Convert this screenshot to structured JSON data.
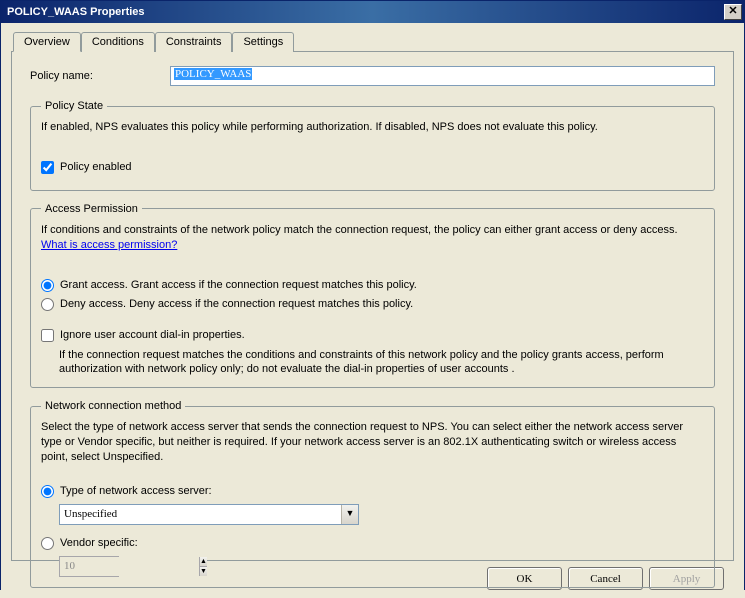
{
  "window": {
    "title": "POLICY_WAAS Properties",
    "close_glyph": "✕"
  },
  "tabs": {
    "overview": "Overview",
    "conditions": "Conditions",
    "constraints": "Constraints",
    "settings": "Settings"
  },
  "policy_name": {
    "label": "Policy name:",
    "value": "POLICY_WAAS"
  },
  "policy_state": {
    "legend": "Policy State",
    "desc": "If enabled, NPS evaluates this policy while performing authorization. If disabled, NPS does not evaluate this policy.",
    "enabled_label": "Policy enabled"
  },
  "access_permission": {
    "legend": "Access Permission",
    "desc_prefix": "If conditions and constraints of the network policy match the connection request, the policy can either grant access or deny access. ",
    "link_text": "What is access permission?",
    "grant_label": "Grant access. Grant access if the connection request matches this policy.",
    "deny_label": "Deny access. Deny access if the connection request matches this policy.",
    "ignore_label": "Ignore user account dial-in properties.",
    "ignore_desc": "If the connection request matches the conditions and constraints of this network policy and the policy grants access, perform authorization with network policy only; do not evaluate the dial-in properties of user accounts ."
  },
  "network_method": {
    "legend": "Network connection method",
    "desc": "Select the type of network access server that sends the connection request to NPS. You can select either the network access server type or Vendor specific, but neither is required.  If your network access server is an 802.1X authenticating switch or wireless access point, select Unspecified.",
    "type_label": "Type of network access server:",
    "type_value": "Unspecified",
    "vendor_label": "Vendor specific:",
    "vendor_value": "10"
  },
  "buttons": {
    "ok": "OK",
    "cancel": "Cancel",
    "apply": "Apply"
  }
}
